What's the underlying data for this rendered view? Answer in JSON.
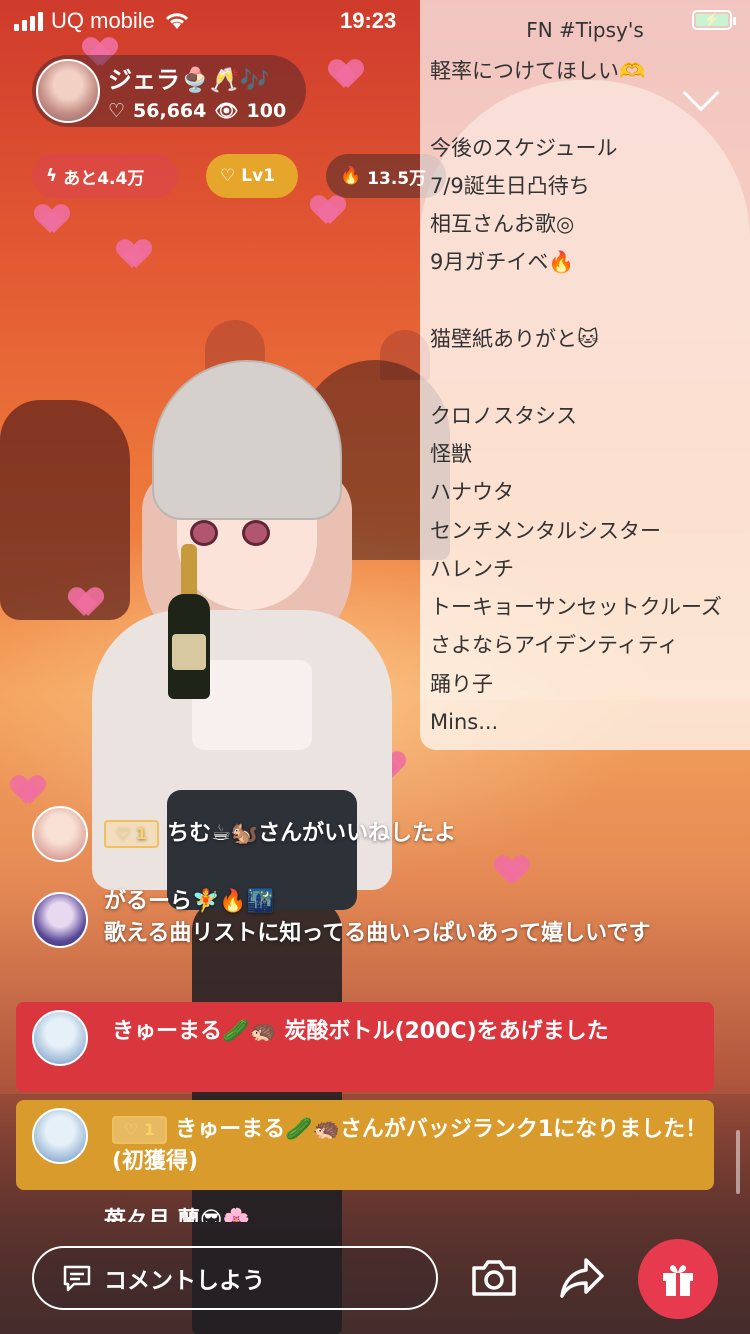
{
  "status_bar": {
    "carrier": "UQ mobile",
    "time": "19:23"
  },
  "streamer": {
    "name": "ジェラ🍨🥂🎶",
    "likes": "56,664",
    "viewers": "100"
  },
  "pills": {
    "remaining": "あと4.4万",
    "level": "Lv1",
    "points": "13.5万"
  },
  "panel": {
    "header": "FN #Tipsy's",
    "lines": [
      "軽率につけてほしい🫶",
      "",
      "今後のスケジュール",
      "7/9誕生日凸待ち",
      "相互さんお歌◎",
      "9月ガチイベ🔥",
      "",
      "猫壁紙ありがと🐱",
      "",
      "クロノスタシス",
      "怪獣",
      "ハナウタ",
      "センチメンタルシスター",
      "ハレンチ",
      "トーキョーサンセットクルーズ",
      "さよならアイデンティティ",
      "踊り子",
      "Mins..."
    ]
  },
  "chat": {
    "like_msg": {
      "badge": "1",
      "text": "ちむ☕🐿️さんがいいねしたよ"
    },
    "comment": {
      "user": "がるーら🧚🔥🌃",
      "text": "歌える曲リストに知ってる曲いっぱいあって嬉しいです"
    },
    "gift_msg": {
      "text": "きゅーまる🥒🦔 炭酸ボトル(200C)をあげました"
    },
    "rank_msg": {
      "badge": "1",
      "text": "きゅーまる🥒🦔さんがバッジランク1になりました！(初獲得)"
    },
    "partial": "苺々月 蘭😎🌸"
  },
  "bottom": {
    "comment_placeholder": "コメントしよう"
  },
  "colors": {
    "gift_button": "#e83a4e",
    "gift_card": "#d9363e",
    "rank_card": "#d99b2b",
    "level_pill": "#e6a52b"
  }
}
